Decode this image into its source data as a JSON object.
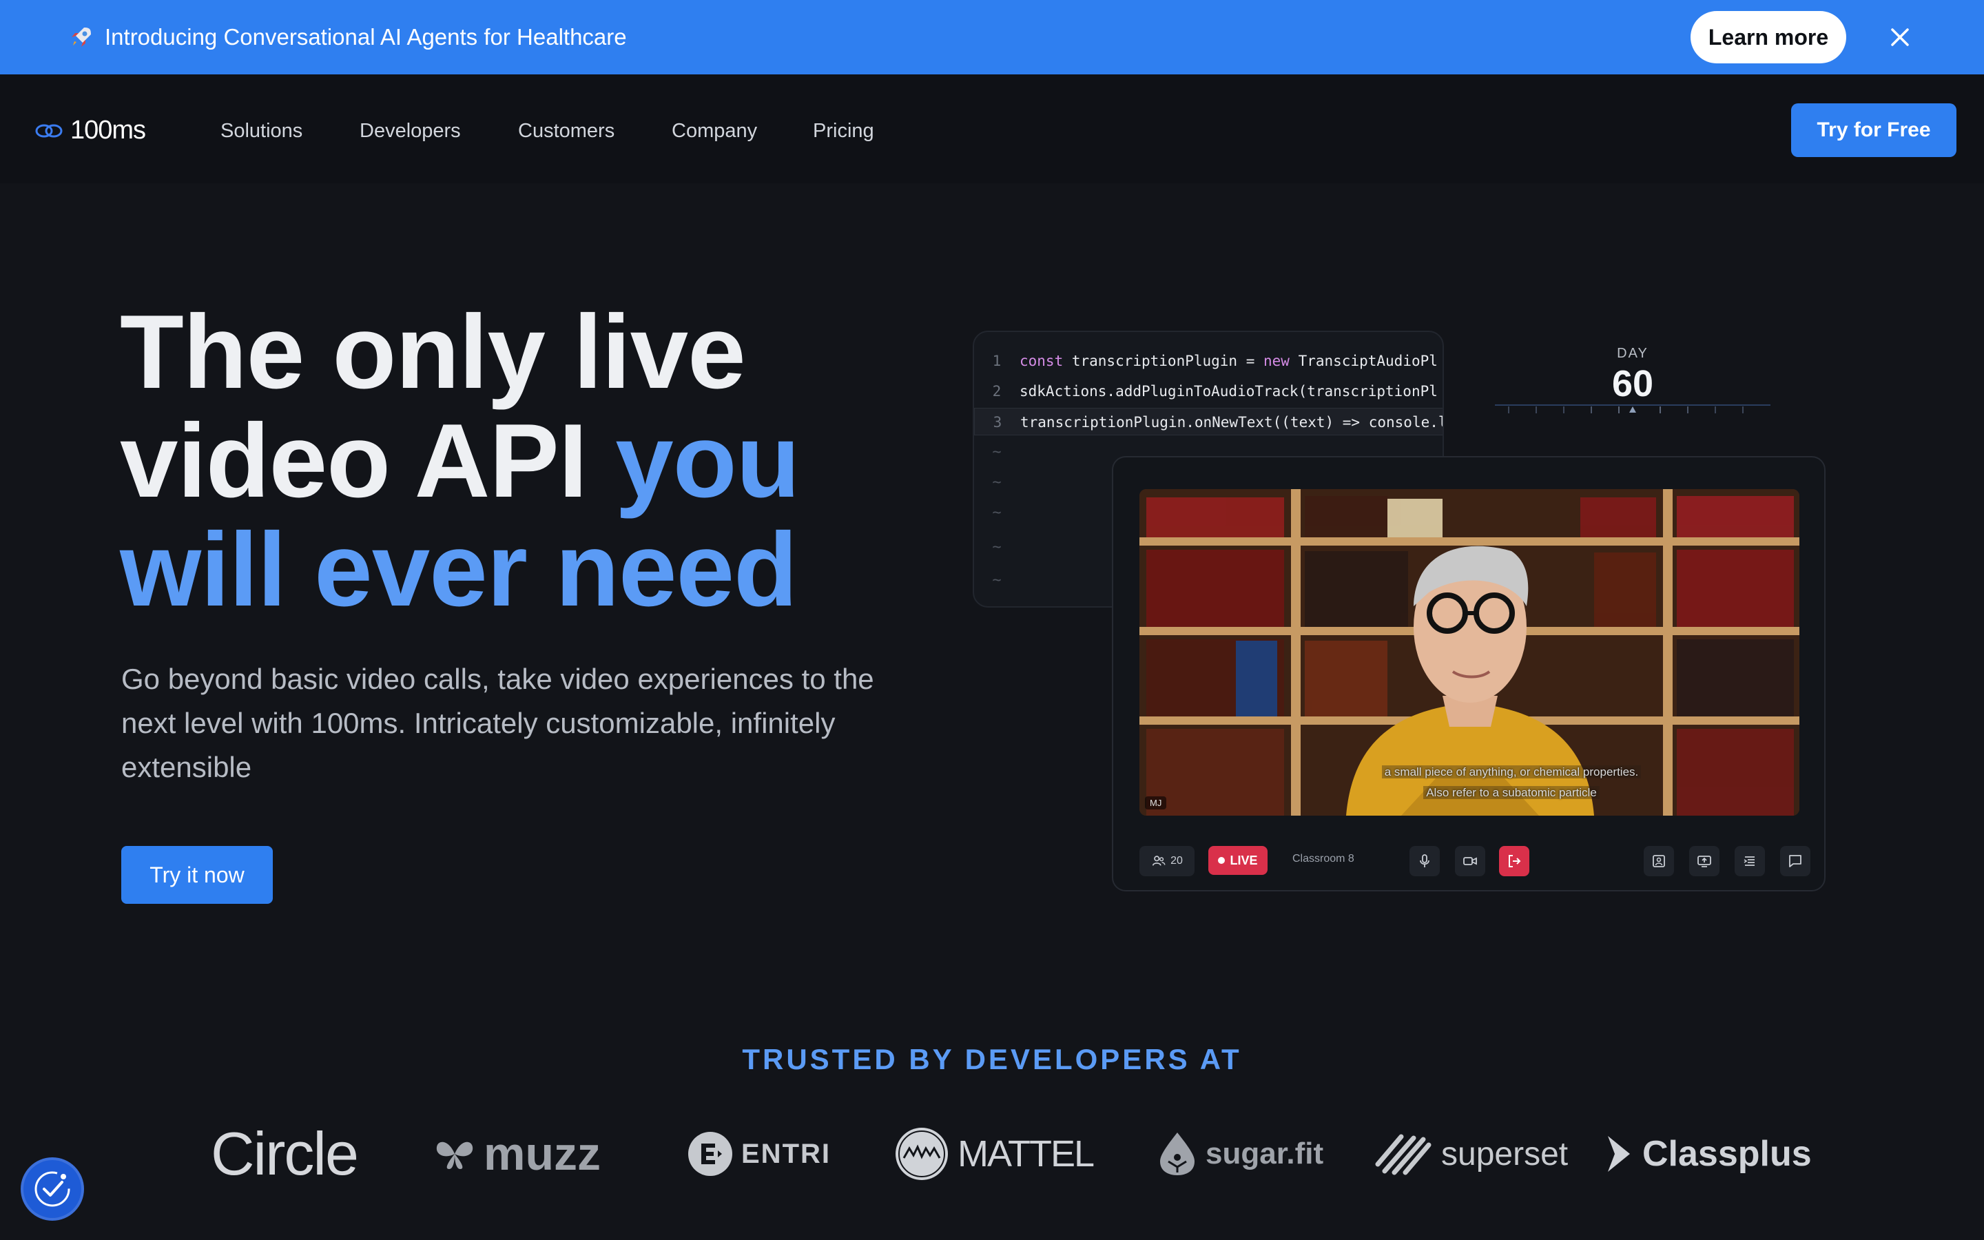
{
  "announcement": {
    "text": "Introducing Conversational AI Agents for Healthcare",
    "cta_label": "Learn more",
    "icon": "rocket-icon"
  },
  "nav": {
    "brand": "100ms",
    "links": [
      "Solutions",
      "Developers",
      "Customers",
      "Company",
      "Pricing"
    ],
    "cta_label": "Try for Free"
  },
  "hero": {
    "title_part1": "The only live video API",
    "title_part2": "you will ever need",
    "subtitle": "Go beyond basic video calls, take video experiences to the next level with 100ms. Intricately customizable, infinitely extensible",
    "cta_label": "Try it now"
  },
  "code": {
    "lines": [
      {
        "num": "1",
        "kw": "const",
        "text": " transcriptionPlugin = ",
        "kw2": "new",
        "text2": " TransciptAudioPl"
      },
      {
        "num": "2",
        "kw": "",
        "text": "sdkActions.addPluginToAudioTrack(transcriptionPl",
        "kw2": "",
        "text2": ""
      },
      {
        "num": "3",
        "kw": "",
        "text": "transcriptionPlugin.onNewText((text) => console.l",
        "kw2": "",
        "text2": ""
      }
    ],
    "tilde": "~"
  },
  "day_counter": {
    "label": "DAY",
    "value": "60"
  },
  "video": {
    "caption_line1": "a small piece of anything, or chemical properties.",
    "caption_line2": "Also refer to a subatomic particle",
    "tile_label": "MJ",
    "participant_count": "20",
    "live_label": "LIVE",
    "room_name": "Classroom 8"
  },
  "trusted": {
    "heading": "TRUSTED BY DEVELOPERS AT",
    "logos": [
      "Circle",
      "muzz",
      "ENTRI",
      "MATTEL",
      "sugar.fit",
      "superset",
      "Classplus"
    ]
  },
  "colors": {
    "accent": "#2f7ff0",
    "highlight": "#5b9bf5",
    "background": "#121419",
    "live": "#d9304a"
  }
}
